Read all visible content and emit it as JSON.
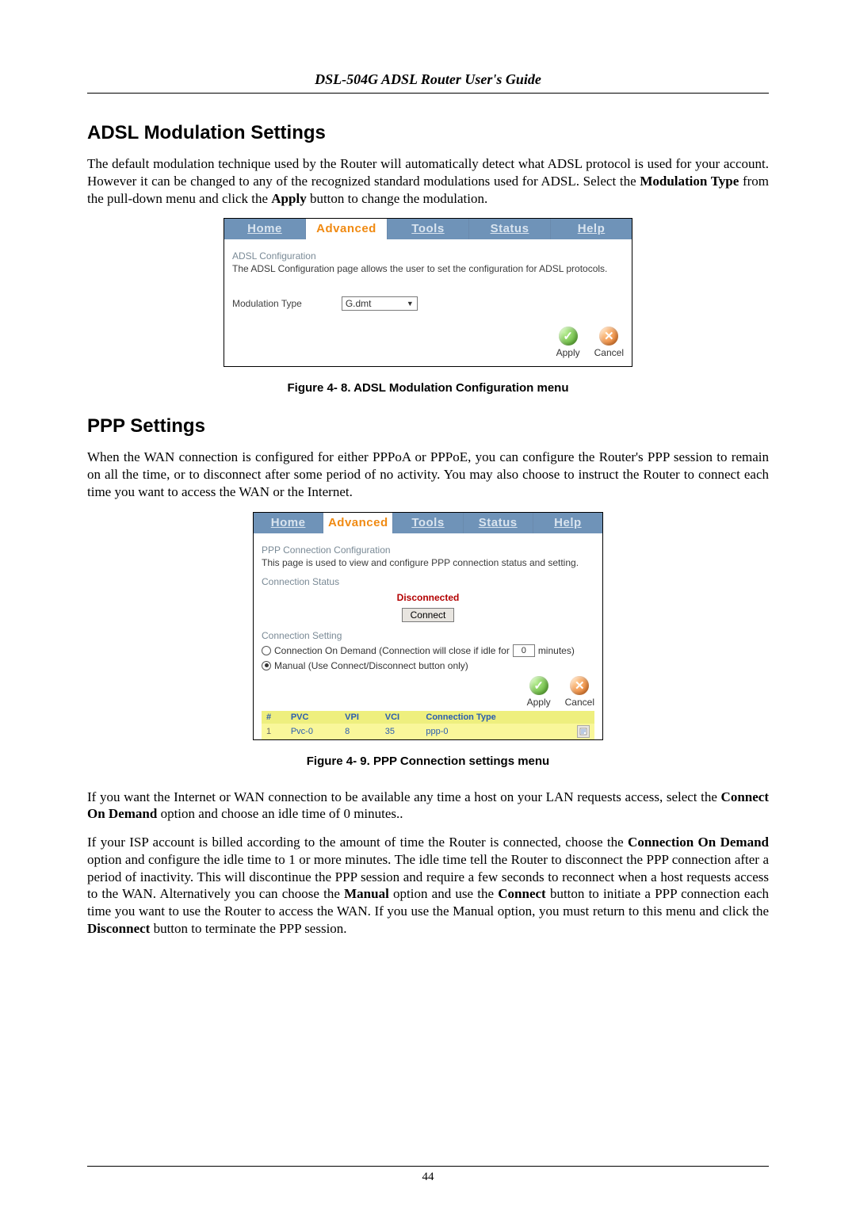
{
  "header": "DSL-504G ADSL Router User's Guide",
  "page_number": "44",
  "sections": {
    "adsl": {
      "heading": "ADSL Modulation Settings",
      "para_a": "The default modulation technique used by the Router will automatically detect what ADSL protocol is used for your account. However it can be changed to any of the recognized standard modulations used for ADSL. Select the ",
      "para_b_bold1": "Modulation Type",
      "para_c": " from the pull-down menu and click the ",
      "para_d_bold2": "Apply",
      "para_e": " button to change the modulation.",
      "caption": "Figure 4- 8. ADSL Modulation Configuration menu"
    },
    "ppp": {
      "heading": "PPP Settings",
      "para1": "When the WAN connection is configured for either PPPoA or PPPoE, you can configure the Router's PPP session to remain on all the time, or to disconnect after some period of no activity. You may also choose to instruct the Router to connect each time you want to access the WAN or the Internet.",
      "caption": "Figure 4- 9. PPP Connection settings menu",
      "para2_a": "If you want the Internet or WAN connection to be available any time a host on your LAN requests access, select the ",
      "para2_b_bold": "Connect On Demand",
      "para2_c": " option and choose an idle time of 0 minutes..",
      "para3_a": "If your ISP account is billed according to the amount of time the Router is connected, choose the ",
      "para3_bold1": "Connection On Demand",
      "para3_b": " option and configure the idle time to 1 or more minutes. The idle time tell the Router to disconnect the PPP connection after a period of inactivity. This will discontinue the PPP session and require a few seconds to reconnect when a host requests access to the WAN. Alternatively you can choose the ",
      "para3_bold2": "Manual",
      "para3_c": " option and use the ",
      "para3_bold3": "Connect",
      "para3_d": " button to initiate a PPP connection each time you want to use the Router to access the WAN. If you use the Manual option, you must return to this menu and click the ",
      "para3_bold4": "Disconnect",
      "para3_e": " button to terminate the PPP session."
    }
  },
  "ui1": {
    "tabs": [
      "Home",
      "Advanced",
      "Tools",
      "Status",
      "Help"
    ],
    "active_tab": 1,
    "section_label": "ADSL Configuration",
    "desc": "The ADSL Configuration page allows the user to set the configuration for ADSL protocols.",
    "mod_label": "Modulation Type",
    "mod_value": "G.dmt",
    "apply_label": "Apply",
    "cancel_label": "Cancel"
  },
  "ui2": {
    "tabs": [
      "Home",
      "Advanced",
      "Tools",
      "Status",
      "Help"
    ],
    "active_tab": 1,
    "section_label": "PPP Connection Configuration",
    "desc": "This page is used to view and configure PPP connection status and setting.",
    "status_label": "Connection Status",
    "status_value": "Disconnected",
    "connect_btn": "Connect",
    "setting_label": "Connection Setting",
    "opt_demand_a": "Connection On Demand (Connection will close if idle for",
    "idle_value": "0",
    "opt_demand_b": "minutes)",
    "opt_manual": "Manual (Use Connect/Disconnect button only)",
    "apply_label": "Apply",
    "cancel_label": "Cancel",
    "table": {
      "headers": [
        "#",
        "PVC",
        "VPI",
        "VCI",
        "Connection Type",
        ""
      ],
      "row": {
        "idx": "1",
        "pvc": "Pvc-0",
        "vpi": "8",
        "vci": "35",
        "ct": "ppp-0"
      }
    }
  }
}
